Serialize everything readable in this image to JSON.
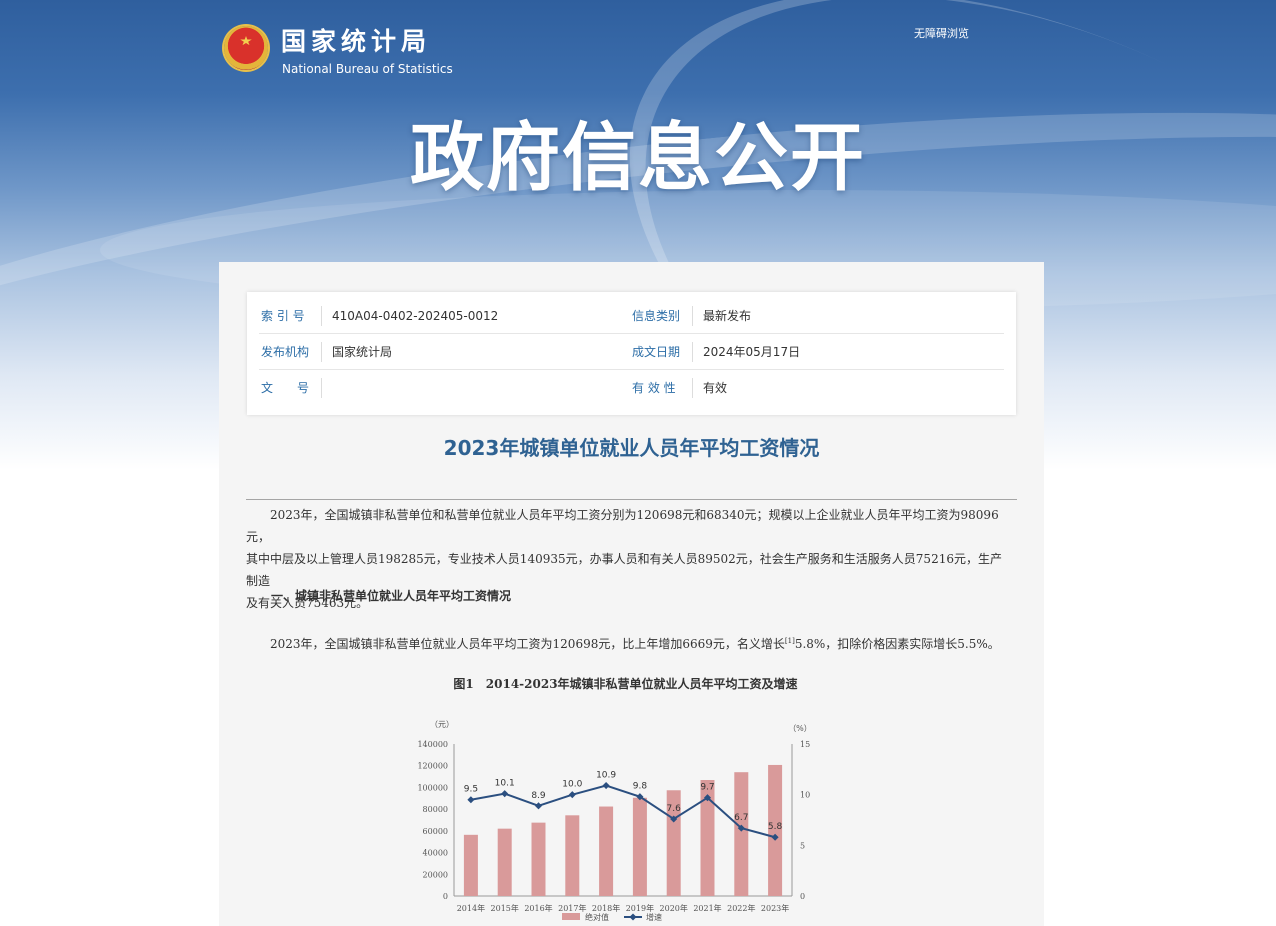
{
  "header": {
    "org_cn": "国家统计局",
    "org_en": "National Bureau of Statistics",
    "accessibility_link": "无障碍浏览",
    "banner_title": "政府信息公开"
  },
  "meta": {
    "index_label": "索 引 号",
    "index_value": "410A04-0402-202405-0012",
    "category_label": "信息类别",
    "category_value": "最新发布",
    "publisher_label": "发布机构",
    "publisher_value": "国家统计局",
    "date_label": "成文日期",
    "date_value": "2024年05月17日",
    "docno_label": "文　　号",
    "docno_value": "",
    "validity_label": "有 效 性",
    "validity_value": "有效"
  },
  "article": {
    "title": "2023年城镇单位就业人员年平均工资情况",
    "intro_line1": "2023年，全国城镇非私营单位和私营单位就业人员年平均工资分别为120698元和68340元；规模以上企业就业人员年平均工资为98096元，",
    "intro_line2": "其中中层及以上管理人员198285元，专业技术人员140935元，办事人员和有关人员89502元，社会生产服务和生活服务人员75216元，生产制造",
    "intro_line3": "及有关人员75463元。",
    "section1_heading": "一、城镇非私营单位就业人员年平均工资情况",
    "section1_para_a": "2023年，全国城镇非私营单位就业人员年平均工资为120698元，比上年增加6669元，名义增长",
    "section1_footnote": "[1]",
    "section1_para_b": "5.8%，扣除价格因素实际增长5.5%。",
    "figure_label": "图1",
    "figure_title": "2014-2023年城镇非私营单位就业人员年平均工资及增速"
  },
  "chart_data": {
    "type": "bar",
    "categories": [
      "2014年",
      "2015年",
      "2016年",
      "2017年",
      "2018年",
      "2019年",
      "2020年",
      "2021年",
      "2022年",
      "2023年"
    ],
    "series": [
      {
        "name": "绝对值",
        "type": "bar",
        "axis": "left",
        "values": [
          56360,
          62029,
          67569,
          74318,
          82413,
          90501,
          97379,
          106837,
          114029,
          120698
        ],
        "color": "#d99a9a"
      },
      {
        "name": "增速",
        "type": "line",
        "axis": "right",
        "values": [
          9.5,
          10.1,
          8.9,
          10.0,
          10.9,
          9.8,
          7.6,
          9.7,
          6.7,
          5.8
        ],
        "color": "#2b4f80"
      }
    ],
    "y_left_unit": "（元）",
    "y_right_unit": "（%）",
    "y_left_ticks": [
      0,
      20000,
      40000,
      60000,
      80000,
      100000,
      120000,
      140000
    ],
    "y_right_ticks": [
      0,
      5,
      10,
      15
    ],
    "ylim_left": [
      0,
      140000
    ],
    "ylim_right": [
      0,
      15
    ],
    "point_labels": [
      "9.5",
      "10.1",
      "8.9",
      "10.0",
      "10.9",
      "9.8",
      "7.6",
      "9.7",
      "6.7",
      "5.8"
    ],
    "legend_position": "bottom-center",
    "grid": false
  }
}
